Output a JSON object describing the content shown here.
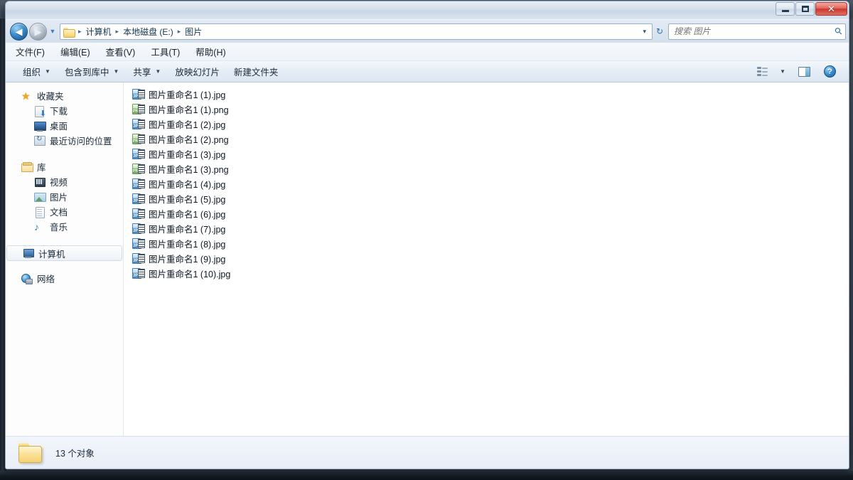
{
  "window": {
    "title": "",
    "controls": {
      "minimize": "最小化",
      "maximize": "最大化",
      "close": "关闭"
    }
  },
  "background": {
    "blurred_text_left": "░░░░  ░░ ░░░ ░░░░ ░ ░░░░░",
    "blurred_text_right": "░░░░░   ░░  ░░░ ░░░░░░"
  },
  "address_bar": {
    "back_label": "后退",
    "forward_label": "前进",
    "history_label": "最近浏览的页面",
    "breadcrumbs": [
      "计算机",
      "本地磁盘 (E:)",
      "图片"
    ],
    "separator": "▸",
    "dropdown": "▾",
    "refresh_label": "刷新"
  },
  "search": {
    "placeholder": "搜索 图片",
    "value": ""
  },
  "menu": {
    "items": [
      {
        "label": "文件(F)",
        "text": "文件",
        "accel": "F"
      },
      {
        "label": "编辑(E)",
        "text": "编辑",
        "accel": "E"
      },
      {
        "label": "查看(V)",
        "text": "查看",
        "accel": "V"
      },
      {
        "label": "工具(T)",
        "text": "工具",
        "accel": "T"
      },
      {
        "label": "帮助(H)",
        "text": "帮助",
        "accel": "H"
      }
    ]
  },
  "toolbar": {
    "buttons": [
      {
        "label": "组织",
        "has_caret": true
      },
      {
        "label": "包含到库中",
        "has_caret": true
      },
      {
        "label": "共享",
        "has_caret": true
      },
      {
        "label": "放映幻灯片",
        "has_caret": false
      },
      {
        "label": "新建文件夹",
        "has_caret": false
      }
    ],
    "caret": "▼",
    "view_button": "更改您的视图",
    "view_caret": "▼",
    "preview_button": "显示预览窗格",
    "help_button": "?"
  },
  "sidebar": {
    "groups": [
      {
        "root": {
          "label": "收藏夹",
          "icon": "star-icon"
        },
        "children": [
          {
            "label": "下载",
            "icon": "download-icon"
          },
          {
            "label": "桌面",
            "icon": "desktop-icon"
          },
          {
            "label": "最近访问的位置",
            "icon": "recent-places-icon"
          }
        ]
      },
      {
        "root": {
          "label": "库",
          "icon": "library-icon"
        },
        "children": [
          {
            "label": "视频",
            "icon": "video-icon"
          },
          {
            "label": "图片",
            "icon": "picture-icon"
          },
          {
            "label": "文档",
            "icon": "document-icon"
          },
          {
            "label": "音乐",
            "icon": "music-icon"
          }
        ]
      },
      {
        "root": {
          "label": "计算机",
          "icon": "computer-icon",
          "selected": true
        },
        "children": []
      },
      {
        "root": {
          "label": "网络",
          "icon": "network-icon"
        },
        "children": []
      }
    ]
  },
  "files": [
    {
      "name": "图片重命名1 (1).jpg",
      "type": "JPG"
    },
    {
      "name": "图片重命名1 (1).png",
      "type": "PNG"
    },
    {
      "name": "图片重命名1 (2).jpg",
      "type": "JPG"
    },
    {
      "name": "图片重命名1 (2).png",
      "type": "PNG"
    },
    {
      "name": "图片重命名1 (3).jpg",
      "type": "JPG"
    },
    {
      "name": "图片重命名1 (3).png",
      "type": "PNG"
    },
    {
      "name": "图片重命名1 (4).jpg",
      "type": "JPG"
    },
    {
      "name": "图片重命名1 (5).jpg",
      "type": "JPG"
    },
    {
      "name": "图片重命名1 (6).jpg",
      "type": "JPG"
    },
    {
      "name": "图片重命名1 (7).jpg",
      "type": "JPG"
    },
    {
      "name": "图片重命名1 (8).jpg",
      "type": "JPG"
    },
    {
      "name": "图片重命名1 (9).jpg",
      "type": "JPG"
    },
    {
      "name": "图片重命名1 (10).jpg",
      "type": "JPG"
    }
  ],
  "status": {
    "count_text": "13 个对象"
  },
  "colors": {
    "accent_blue": "#3a8fd0",
    "jpg_icon": "#4d8fc9",
    "png_icon": "#78b05f",
    "close_red": "#c8382c",
    "folder_yellow": "#f5d072"
  }
}
